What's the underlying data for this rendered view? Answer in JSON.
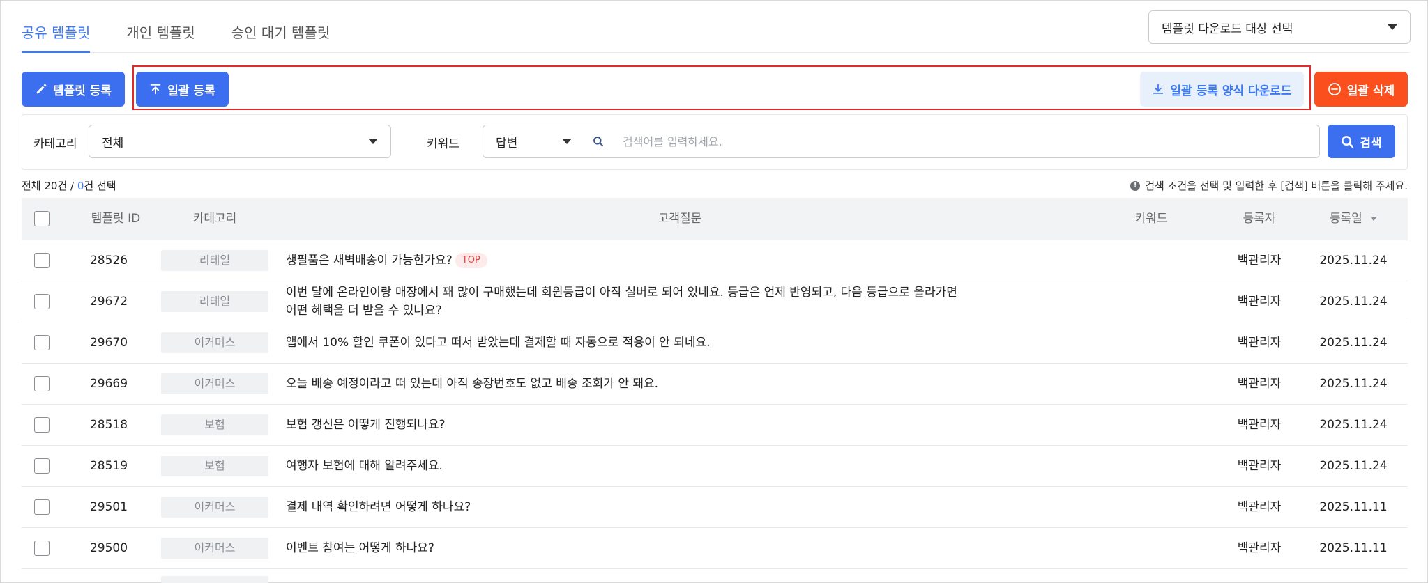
{
  "tabs": [
    {
      "label": "공유 템플릿",
      "active": true
    },
    {
      "label": "개인 템플릿",
      "active": false
    },
    {
      "label": "승인 대기 템플릿",
      "active": false
    }
  ],
  "download_target_select": {
    "value": "템플릿 다운로드 대상 선택"
  },
  "toolbar": {
    "register_label": "템플릿 등록",
    "bulk_register_label": "일괄 등록",
    "download_form_label": "일괄 등록 양식 다운로드",
    "bulk_delete_label": "일괄 삭제"
  },
  "search": {
    "category_label": "카테고리",
    "category_value": "전체",
    "keyword_label": "키워드",
    "keyword_type_value": "답변",
    "placeholder": "검색어를 입력하세요.",
    "button_label": "검색"
  },
  "summary": {
    "total_prefix": "전체 20건 / ",
    "selected_count": "0",
    "selected_suffix": "건 선택",
    "hint": "검색 조건을 선택 및 입력한 후 [검색] 버튼을 클릭해 주세요."
  },
  "table": {
    "headers": {
      "id": "템플릿 ID",
      "category": "카테고리",
      "question": "고객질문",
      "keyword": "키워드",
      "registrant": "등록자",
      "date": "등록일"
    },
    "rows": [
      {
        "id": "28526",
        "category": "리테일",
        "question": "생필품은 새벽배송이 가능한가요?",
        "badge": "TOP",
        "registrant": "백관리자",
        "date": "2025.11.24"
      },
      {
        "id": "29672",
        "category": "리테일",
        "question": "이번 달에 온라인이랑 매장에서 꽤 많이 구매했는데 회원등급이 아직 실버로 되어 있네요. 등급은 언제 반영되고, 다음 등급으로 올라가면 어떤 혜택을 더 받을 수 있나요?",
        "badge": "",
        "registrant": "백관리자",
        "date": "2025.11.24"
      },
      {
        "id": "29670",
        "category": "이커머스",
        "question": "앱에서 10% 할인 쿠폰이 있다고 떠서 받았는데 결제할 때 자동으로 적용이 안 되네요.",
        "badge": "",
        "registrant": "백관리자",
        "date": "2025.11.24"
      },
      {
        "id": "29669",
        "category": "이커머스",
        "question": "오늘 배송 예정이라고 떠 있는데 아직 송장번호도 없고 배송 조회가 안 돼요.",
        "badge": "",
        "registrant": "백관리자",
        "date": "2025.11.24"
      },
      {
        "id": "28518",
        "category": "보험",
        "question": "보험 갱신은 어떻게 진행되나요?",
        "badge": "",
        "registrant": "백관리자",
        "date": "2025.11.24"
      },
      {
        "id": "28519",
        "category": "보험",
        "question": "여행자 보험에 대해 알려주세요.",
        "badge": "",
        "registrant": "백관리자",
        "date": "2025.11.24"
      },
      {
        "id": "29501",
        "category": "이커머스",
        "question": "결제 내역 확인하려면 어떻게 하나요?",
        "badge": "",
        "registrant": "백관리자",
        "date": "2025.11.11"
      },
      {
        "id": "29500",
        "category": "이커머스",
        "question": "이벤트 참여는 어떻게 하나요?",
        "badge": "",
        "registrant": "백관리자",
        "date": "2025.11.11"
      }
    ]
  },
  "colors": {
    "accent": "#3c6ff0",
    "danger": "#fb4f1e",
    "highlight": "#e12a2a"
  }
}
